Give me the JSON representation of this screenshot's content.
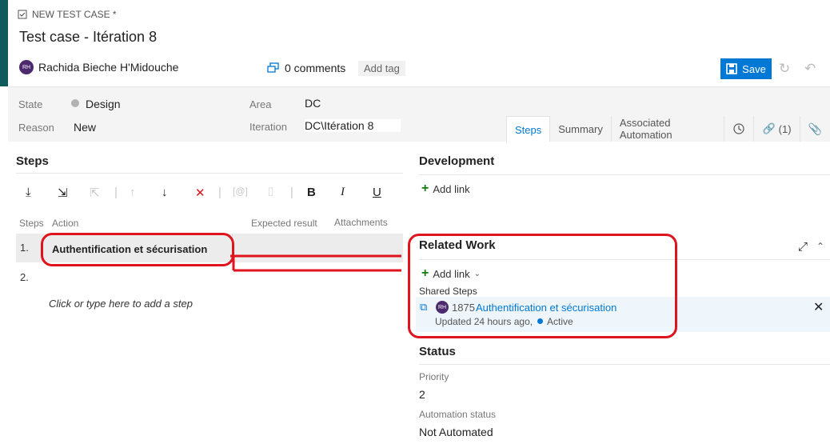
{
  "header": {
    "crumb": "NEW TEST CASE *",
    "title": "Test case - Itération 8",
    "owner_initials": "RH",
    "owner_name": "Rachida Bieche H'Midouche",
    "comments": "0 comments",
    "add_tag": "Add tag",
    "save_label": "Save"
  },
  "fields": {
    "state_label": "State",
    "state_value": "Design",
    "reason_label": "Reason",
    "reason_value": "New",
    "area_label": "Area",
    "area_value": "DC",
    "iteration_label": "Iteration",
    "iteration_value": "DC\\Itération 8"
  },
  "tabs": {
    "steps": "Steps",
    "summary": "Summary",
    "automation": "Associated Automation",
    "links": "(1)"
  },
  "steps": {
    "title": "Steps",
    "col_steps": "Steps",
    "col_action": "Action",
    "col_expected": "Expected result",
    "col_attachments": "Attachments",
    "rows": [
      {
        "num": "1.",
        "action": "Authentification et sécurisation"
      },
      {
        "num": "2.",
        "action": ""
      }
    ],
    "hint": "Click or type here to add a step"
  },
  "development": {
    "title": "Development",
    "add_link": "Add link"
  },
  "related_work": {
    "title": "Related Work",
    "add_link": "Add link",
    "group": "Shared Steps",
    "item_initials": "RH",
    "item_id": "1875",
    "item_title": "Authentification et sécurisation",
    "item_updated": "Updated 24 hours ago,",
    "item_state": "Active"
  },
  "status": {
    "title": "Status",
    "priority_label": "Priority",
    "priority_value": "2",
    "automation_label": "Automation status",
    "automation_value": "Not Automated"
  },
  "colors": {
    "accent": "#0e5a5c",
    "primary": "#0078d4",
    "annotation": "#e0141e",
    "active_dot": "#0078d4"
  }
}
